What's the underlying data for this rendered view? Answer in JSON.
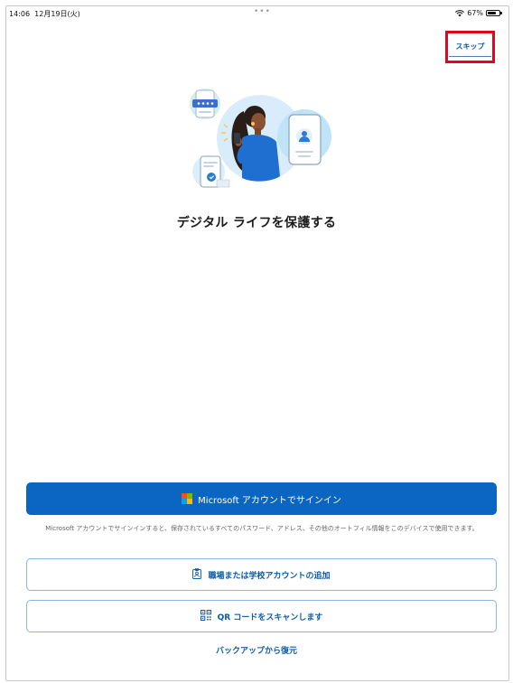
{
  "status_bar": {
    "time": "14:06",
    "date": "12月19日(火)",
    "dots": "•••",
    "battery": "67%"
  },
  "skip": {
    "label": "スキップ"
  },
  "title": "デジタル ライフを保護する",
  "primary": {
    "label": "Microsoft アカウントでサインイン"
  },
  "info_text": "Microsoft アカウントでサインインすると、保存されているすべてのパスワード、アドレス、その他のオートフィル情報をこのデバイスで使用できます。",
  "buttons": {
    "work_account": "職場または学校アカウントの追加",
    "qr_scan": "QR コードをスキャンします",
    "restore": "バックアップから復元"
  },
  "colors": {
    "accent": "#0a66c2",
    "link": "#0d5ca8",
    "highlight": "#e1071f"
  },
  "icons": {
    "wifi": "wifi-icon",
    "battery": "battery-icon",
    "microsoft_logo": "microsoft-logo-icon",
    "badge": "id-badge-icon",
    "qr": "qr-code-icon"
  }
}
